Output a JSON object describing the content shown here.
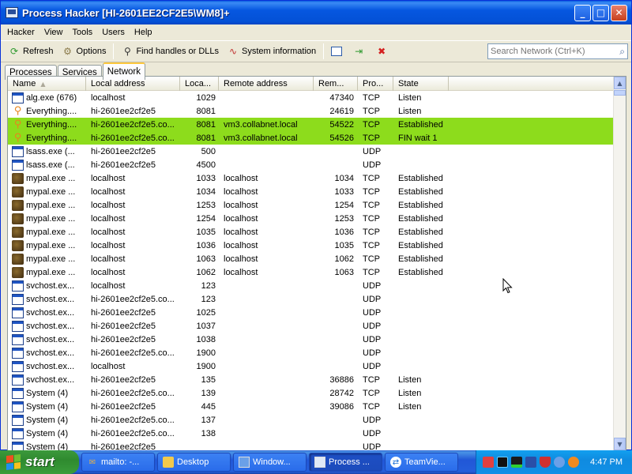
{
  "window": {
    "title": "Process Hacker [HI-2601EE2CF2E5\\WM8]+",
    "buttons": {
      "minimize": "_",
      "maximize": "□",
      "close": "✕"
    }
  },
  "menu": [
    "Hacker",
    "View",
    "Tools",
    "Users",
    "Help"
  ],
  "toolbar": {
    "refresh": "Refresh",
    "options": "Options",
    "find_handles": "Find handles or DLLs",
    "system_information": "System information",
    "search_placeholder": "Search Network (Ctrl+K)"
  },
  "tabs": [
    {
      "label": "Processes",
      "active": false
    },
    {
      "label": "Services",
      "active": false
    },
    {
      "label": "Network",
      "active": true
    }
  ],
  "grid": {
    "columns": [
      "Name",
      "Local address",
      "Loca...",
      "Remote address",
      "Rem...",
      "Pro...",
      "State"
    ],
    "rows": [
      {
        "icon": "window-icon",
        "name": "alg.exe (676)",
        "local": "localhost",
        "lport": "1029",
        "remote": "",
        "rport": "47340",
        "proto": "TCP",
        "state": "Listen",
        "highlight": false
      },
      {
        "icon": "search-process-icon",
        "name": "Everything....",
        "local": "hi-2601ee2cf2e5",
        "lport": "8081",
        "remote": "",
        "rport": "24619",
        "proto": "TCP",
        "state": "Listen",
        "highlight": false
      },
      {
        "icon": "search-process-icon",
        "name": "Everything....",
        "local": "hi-2601ee2cf2e5.co...",
        "lport": "8081",
        "remote": "vm3.collabnet.local",
        "rport": "54522",
        "proto": "TCP",
        "state": "Established",
        "highlight": true
      },
      {
        "icon": "search-process-icon",
        "name": "Everything....",
        "local": "hi-2601ee2cf2e5.co...",
        "lport": "8081",
        "remote": "vm3.collabnet.local",
        "rport": "54526",
        "proto": "TCP",
        "state": "FIN wait 1",
        "highlight": true
      },
      {
        "icon": "window-icon",
        "name": "lsass.exe (...",
        "local": "hi-2601ee2cf2e5",
        "lport": "500",
        "remote": "",
        "rport": "",
        "proto": "UDP",
        "state": "",
        "highlight": false
      },
      {
        "icon": "window-icon",
        "name": "lsass.exe (...",
        "local": "hi-2601ee2cf2e5",
        "lport": "4500",
        "remote": "",
        "rport": "",
        "proto": "UDP",
        "state": "",
        "highlight": false
      },
      {
        "icon": "mypal-icon",
        "name": "mypal.exe ...",
        "local": "localhost",
        "lport": "1033",
        "remote": "localhost",
        "rport": "1034",
        "proto": "TCP",
        "state": "Established",
        "highlight": false
      },
      {
        "icon": "mypal-icon",
        "name": "mypal.exe ...",
        "local": "localhost",
        "lport": "1034",
        "remote": "localhost",
        "rport": "1033",
        "proto": "TCP",
        "state": "Established",
        "highlight": false
      },
      {
        "icon": "mypal-icon",
        "name": "mypal.exe ...",
        "local": "localhost",
        "lport": "1253",
        "remote": "localhost",
        "rport": "1254",
        "proto": "TCP",
        "state": "Established",
        "highlight": false
      },
      {
        "icon": "mypal-icon",
        "name": "mypal.exe ...",
        "local": "localhost",
        "lport": "1254",
        "remote": "localhost",
        "rport": "1253",
        "proto": "TCP",
        "state": "Established",
        "highlight": false
      },
      {
        "icon": "mypal-icon",
        "name": "mypal.exe ...",
        "local": "localhost",
        "lport": "1035",
        "remote": "localhost",
        "rport": "1036",
        "proto": "TCP",
        "state": "Established",
        "highlight": false
      },
      {
        "icon": "mypal-icon",
        "name": "mypal.exe ...",
        "local": "localhost",
        "lport": "1036",
        "remote": "localhost",
        "rport": "1035",
        "proto": "TCP",
        "state": "Established",
        "highlight": false
      },
      {
        "icon": "mypal-icon",
        "name": "mypal.exe ...",
        "local": "localhost",
        "lport": "1063",
        "remote": "localhost",
        "rport": "1062",
        "proto": "TCP",
        "state": "Established",
        "highlight": false
      },
      {
        "icon": "mypal-icon",
        "name": "mypal.exe ...",
        "local": "localhost",
        "lport": "1062",
        "remote": "localhost",
        "rport": "1063",
        "proto": "TCP",
        "state": "Established",
        "highlight": false
      },
      {
        "icon": "window-icon",
        "name": "svchost.ex...",
        "local": "localhost",
        "lport": "123",
        "remote": "",
        "rport": "",
        "proto": "UDP",
        "state": "",
        "highlight": false
      },
      {
        "icon": "window-icon",
        "name": "svchost.ex...",
        "local": "hi-2601ee2cf2e5.co...",
        "lport": "123",
        "remote": "",
        "rport": "",
        "proto": "UDP",
        "state": "",
        "highlight": false
      },
      {
        "icon": "window-icon",
        "name": "svchost.ex...",
        "local": "hi-2601ee2cf2e5",
        "lport": "1025",
        "remote": "",
        "rport": "",
        "proto": "UDP",
        "state": "",
        "highlight": false
      },
      {
        "icon": "window-icon",
        "name": "svchost.ex...",
        "local": "hi-2601ee2cf2e5",
        "lport": "1037",
        "remote": "",
        "rport": "",
        "proto": "UDP",
        "state": "",
        "highlight": false
      },
      {
        "icon": "window-icon",
        "name": "svchost.ex...",
        "local": "hi-2601ee2cf2e5",
        "lport": "1038",
        "remote": "",
        "rport": "",
        "proto": "UDP",
        "state": "",
        "highlight": false
      },
      {
        "icon": "window-icon",
        "name": "svchost.ex...",
        "local": "hi-2601ee2cf2e5.co...",
        "lport": "1900",
        "remote": "",
        "rport": "",
        "proto": "UDP",
        "state": "",
        "highlight": false
      },
      {
        "icon": "window-icon",
        "name": "svchost.ex...",
        "local": "localhost",
        "lport": "1900",
        "remote": "",
        "rport": "",
        "proto": "UDP",
        "state": "",
        "highlight": false
      },
      {
        "icon": "window-icon",
        "name": "svchost.ex...",
        "local": "hi-2601ee2cf2e5",
        "lport": "135",
        "remote": "",
        "rport": "36886",
        "proto": "TCP",
        "state": "Listen",
        "highlight": false
      },
      {
        "icon": "window-icon",
        "name": "System (4)",
        "local": "hi-2601ee2cf2e5.co...",
        "lport": "139",
        "remote": "",
        "rport": "28742",
        "proto": "TCP",
        "state": "Listen",
        "highlight": false
      },
      {
        "icon": "window-icon",
        "name": "System (4)",
        "local": "hi-2601ee2cf2e5",
        "lport": "445",
        "remote": "",
        "rport": "39086",
        "proto": "TCP",
        "state": "Listen",
        "highlight": false
      },
      {
        "icon": "window-icon",
        "name": "System (4)",
        "local": "hi-2601ee2cf2e5.co...",
        "lport": "137",
        "remote": "",
        "rport": "",
        "proto": "UDP",
        "state": "",
        "highlight": false
      },
      {
        "icon": "window-icon",
        "name": "System (4)",
        "local": "hi-2601ee2cf2e5.co...",
        "lport": "138",
        "remote": "",
        "rport": "",
        "proto": "UDP",
        "state": "",
        "highlight": false
      },
      {
        "icon": "window-icon",
        "name": "System (4)",
        "local": "hi-2601ee2cf2e5",
        "lport": "",
        "remote": "",
        "rport": "",
        "proto": "UDP",
        "state": "",
        "highlight": false
      }
    ]
  },
  "colors": {
    "highlight_row": "#8ddc1c",
    "title_bar": "#0657e0",
    "tab_accent": "#ffc83c"
  },
  "taskbar": {
    "start_label": "start",
    "tasks": [
      {
        "label": "mailto: -...",
        "icon": "mail-icon",
        "active": false
      },
      {
        "label": "Desktop",
        "icon": "folder-icon",
        "active": false
      },
      {
        "label": "Window...",
        "icon": "computer-icon",
        "active": false
      },
      {
        "label": "Process ...",
        "icon": "process-hacker-icon",
        "active": true
      },
      {
        "label": "TeamVie...",
        "icon": "teamviewer-icon",
        "active": false
      }
    ],
    "clock": "4:47 PM"
  }
}
